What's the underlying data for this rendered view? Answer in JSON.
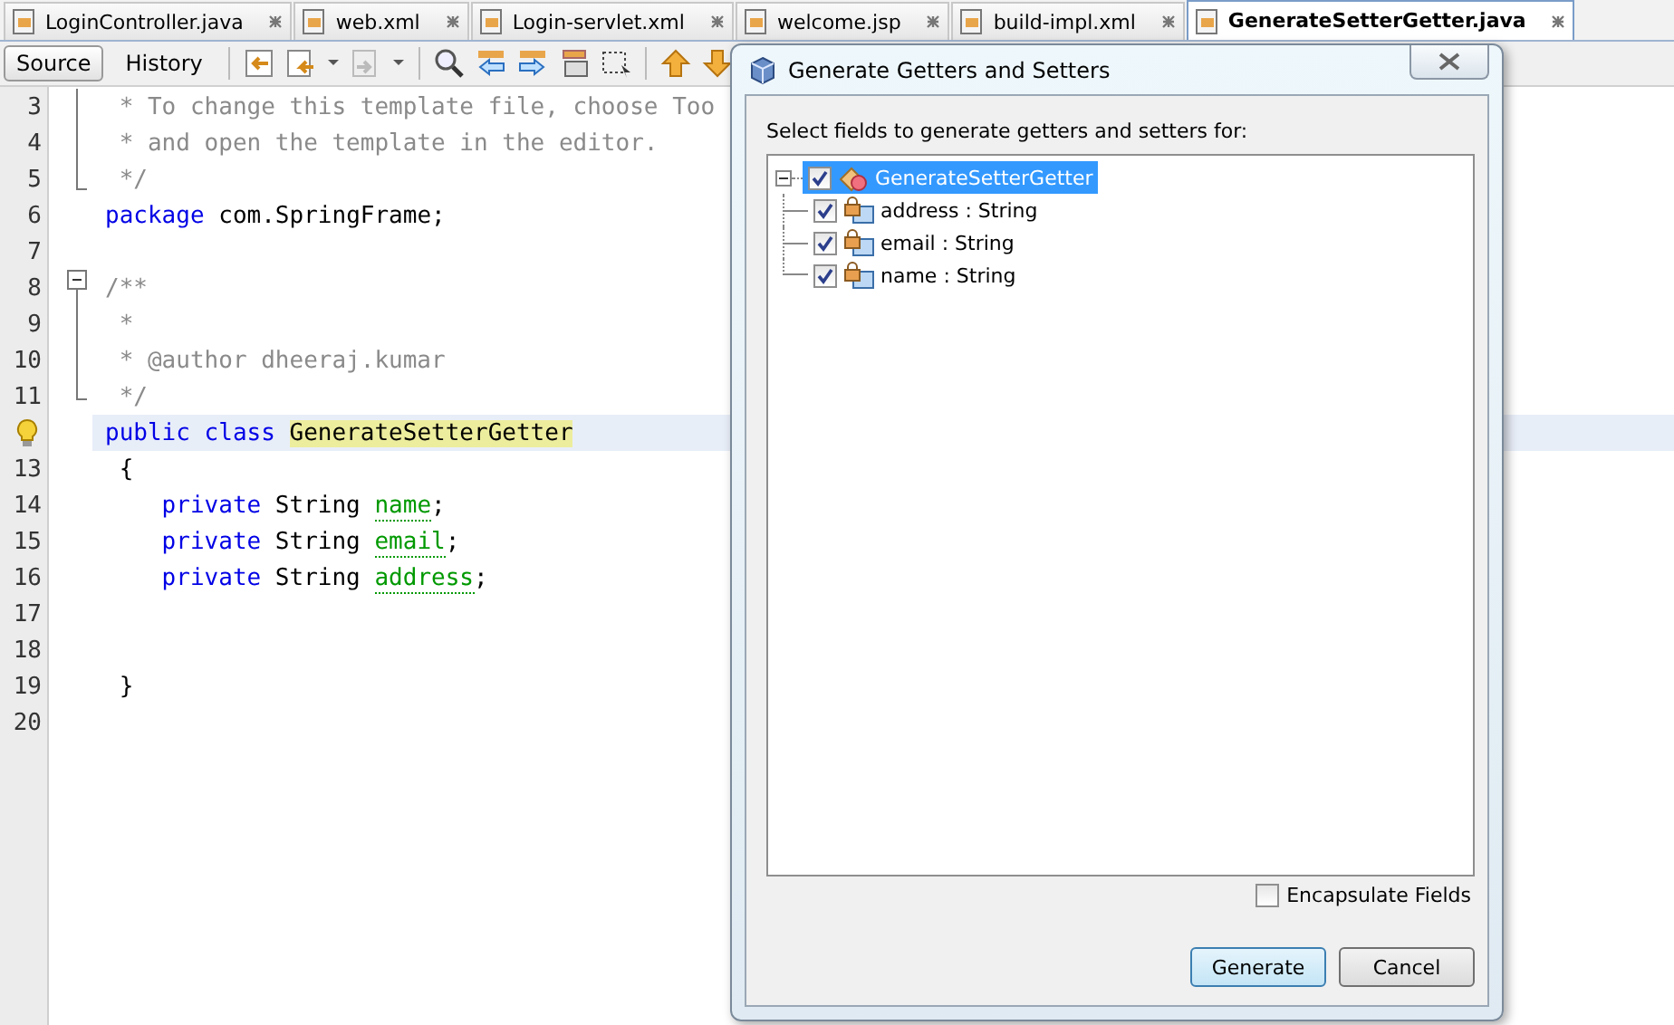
{
  "file_tabs": [
    {
      "label": "LoginController.java",
      "selected": false
    },
    {
      "label": "web.xml",
      "selected": false
    },
    {
      "label": "Login-servlet.xml",
      "selected": false
    },
    {
      "label": "welcome.jsp",
      "selected": false
    },
    {
      "label": "build-impl.xml",
      "selected": false
    },
    {
      "label": "GenerateSetterGetter.java",
      "selected": true
    }
  ],
  "view_tabs": [
    {
      "label": "Source",
      "selected": true
    },
    {
      "label": "History",
      "selected": false
    }
  ],
  "editor": {
    "lines": [
      {
        "number": "3",
        "kind": "foldbody",
        "current": false,
        "tokens": [
          {
            "kind": "comment",
            "text": " * To change this template file, choose Too"
          }
        ]
      },
      {
        "number": "4",
        "kind": "foldbody",
        "current": false,
        "tokens": [
          {
            "kind": "comment",
            "text": " * and open the template in the editor."
          }
        ]
      },
      {
        "number": "5",
        "kind": "foldend",
        "current": false,
        "tokens": [
          {
            "kind": "comment",
            "text": " */"
          }
        ]
      },
      {
        "number": "6",
        "kind": "plain",
        "current": false,
        "tokens": [
          {
            "kind": "keyword",
            "text": "package"
          },
          {
            "kind": "plain",
            "text": " com.SpringFrame;"
          }
        ]
      },
      {
        "number": "7",
        "kind": "plain",
        "current": false
      },
      {
        "number": "8",
        "kind": "foldstart",
        "current": false,
        "tokens": [
          {
            "kind": "comment",
            "text": "/**"
          }
        ]
      },
      {
        "number": "9",
        "kind": "foldbody",
        "current": false,
        "tokens": [
          {
            "kind": "comment",
            "text": " *"
          }
        ]
      },
      {
        "number": "10",
        "kind": "foldbody",
        "current": false,
        "tokens": [
          {
            "kind": "comment",
            "text": " * @author dheeraj.kumar"
          }
        ]
      },
      {
        "number": "11",
        "kind": "foldend",
        "current": false,
        "tokens": [
          {
            "kind": "comment",
            "text": " */"
          }
        ]
      },
      {
        "kind": "hint",
        "current": true,
        "tokens": [
          {
            "kind": "keyword",
            "text": "public class "
          },
          {
            "kind": "highlight",
            "text": "GenerateSetterGetter"
          }
        ]
      },
      {
        "number": "13",
        "kind": "plain",
        "current": false,
        "tokens": [
          {
            "kind": "plain",
            "text": " {"
          }
        ]
      },
      {
        "number": "14",
        "kind": "plain",
        "current": false,
        "tokens": [
          {
            "kind": "keyword",
            "text": "    private"
          },
          {
            "kind": "plain",
            "text": " String "
          },
          {
            "kind": "field",
            "text": "name"
          },
          {
            "kind": "plain",
            "text": ";"
          }
        ]
      },
      {
        "number": "15",
        "kind": "plain",
        "current": false,
        "tokens": [
          {
            "kind": "keyword",
            "text": "    private"
          },
          {
            "kind": "plain",
            "text": " String "
          },
          {
            "kind": "field",
            "text": "email"
          },
          {
            "kind": "plain",
            "text": ";"
          }
        ]
      },
      {
        "number": "16",
        "kind": "plain",
        "current": false,
        "tokens": [
          {
            "kind": "keyword",
            "text": "    private"
          },
          {
            "kind": "plain",
            "text": " String "
          },
          {
            "kind": "field",
            "text": "address"
          },
          {
            "kind": "plain",
            "text": ";"
          }
        ]
      },
      {
        "number": "17",
        "kind": "plain",
        "current": false
      },
      {
        "number": "18",
        "kind": "plain",
        "current": false
      },
      {
        "number": "19",
        "kind": "plain",
        "current": false,
        "tokens": [
          {
            "kind": "plain",
            "text": " }"
          }
        ]
      },
      {
        "number": "20",
        "kind": "plain",
        "current": false
      }
    ]
  },
  "dialog": {
    "title": "Generate Getters and Setters",
    "prompt": "Select fields to generate getters and setters for:",
    "tree": {
      "label": "GenerateSetterGetter",
      "checked": true,
      "selected": true,
      "expanded": true,
      "children": [
        {
          "label": "address : String",
          "checked": true,
          "selected": false
        },
        {
          "label": "email : String",
          "checked": true,
          "selected": false
        },
        {
          "label": "name : String",
          "checked": true,
          "selected": false
        }
      ]
    },
    "encapsulate": {
      "label": "Encapsulate Fields",
      "checked": false
    },
    "buttons": [
      {
        "label": "Generate",
        "kind": "default"
      },
      {
        "label": "Cancel",
        "kind": "normal"
      }
    ]
  }
}
